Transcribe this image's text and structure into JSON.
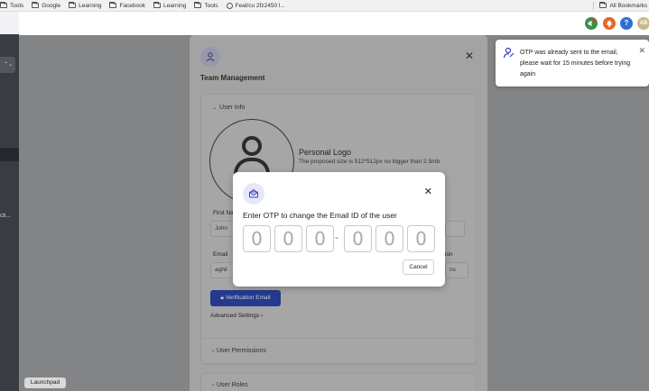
{
  "bookmarks": {
    "items": [
      {
        "label": "Tools",
        "icon": "folder-icon"
      },
      {
        "label": "Google",
        "icon": "folder-icon"
      },
      {
        "label": "Learning",
        "icon": "folder-icon"
      },
      {
        "label": "Facebook",
        "icon": "folder-icon"
      },
      {
        "label": "Learning",
        "icon": "folder-icon"
      },
      {
        "label": "Tools",
        "icon": "folder-icon"
      },
      {
        "label": "Feat/cu 2fz2450 l...",
        "icon": "globe-icon"
      }
    ],
    "all_bookmarks": "All Bookmarks"
  },
  "sidebar": {
    "select_symbol": "⌃⌄",
    "truncated_text": "cti..."
  },
  "topbar": {
    "avatar_initials": "AB",
    "help_symbol": "?"
  },
  "panel": {
    "title": "Team Management",
    "user_info_label": "User Info",
    "personal_logo_title": "Personal Logo",
    "personal_logo_hint": "The proposed size is 512*512px no bigger than 2.5mb",
    "first_name_label": "First Na",
    "first_name_value": "John",
    "email_label": "Email",
    "email_value": "aghil",
    "right_field_label": "ion",
    "right_field_value": "ns",
    "verification_button": "Verification Email",
    "advanced_settings": "Advanced Settings",
    "user_permissions": "User Permissions",
    "user_roles": "User Roles"
  },
  "toast": {
    "message": "OTP was already sent to the email, please wait for 15 minutes before trying again"
  },
  "modal": {
    "title": "Enter OTP to change the Email ID of the user",
    "otp_digits": [
      "0",
      "0",
      "0",
      "0",
      "0",
      "0"
    ],
    "separator": "-",
    "cancel_label": "Cancel"
  },
  "dock": {
    "launchpad_tooltip": "Launchpad"
  },
  "colors": {
    "primary": "#243a8c",
    "megaphone": "#3b8f4a",
    "bell": "#e2692a",
    "help": "#2f6fd6",
    "avatar": "#c9b98a"
  }
}
